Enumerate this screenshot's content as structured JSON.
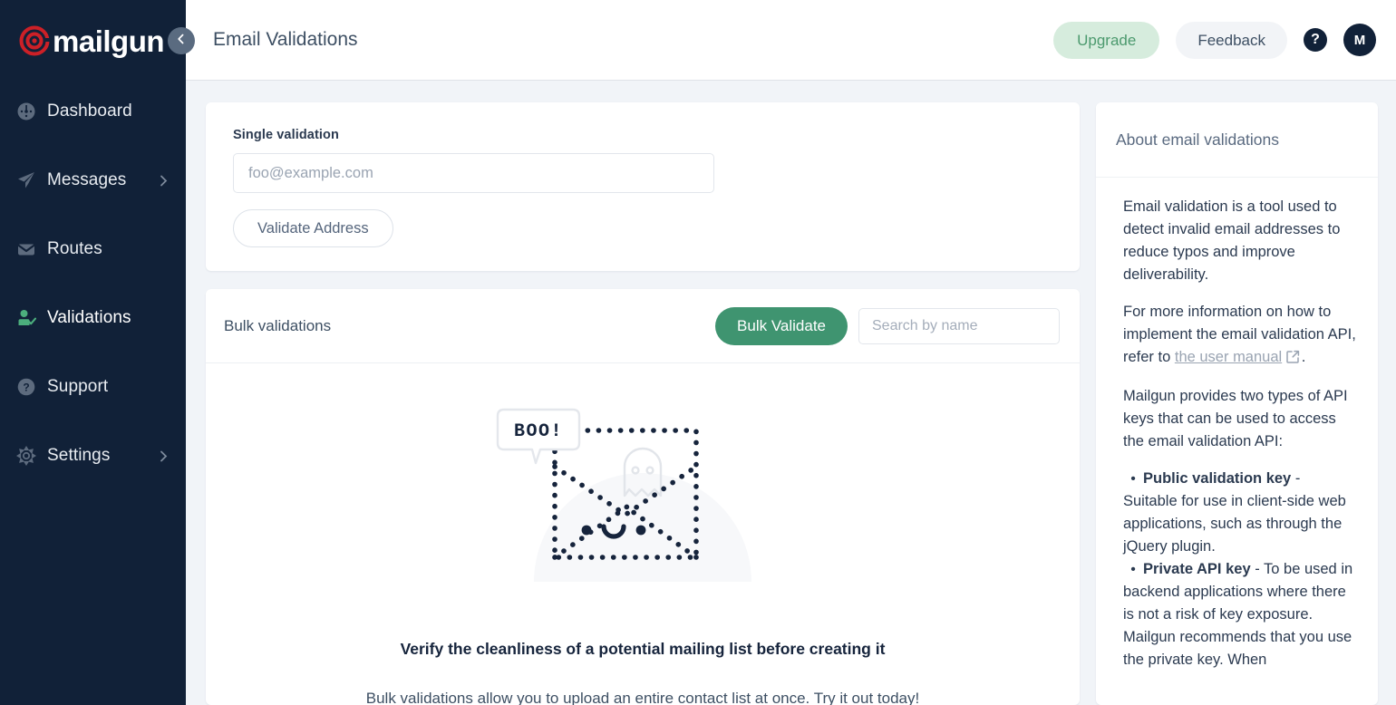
{
  "brand": {
    "name": "mailgun",
    "logo_mark": "at-sign-icon",
    "accent_green": "#3f9470",
    "sidebar_bg": "#112138"
  },
  "sidebar": {
    "collapse_icon": "chevron-left-icon",
    "items": [
      {
        "label": "Dashboard",
        "icon": "gauge-icon",
        "active": false,
        "chevron": false
      },
      {
        "label": "Messages",
        "icon": "paper-plane-icon",
        "active": false,
        "chevron": true
      },
      {
        "label": "Routes",
        "icon": "envelope-icon",
        "active": false,
        "chevron": false
      },
      {
        "label": "Validations",
        "icon": "user-check-icon",
        "active": true,
        "chevron": false
      },
      {
        "label": "Support",
        "icon": "question-circle-icon",
        "active": false,
        "chevron": false
      },
      {
        "label": "Settings",
        "icon": "gear-icon",
        "active": false,
        "chevron": true
      }
    ]
  },
  "header": {
    "title": "Email Validations",
    "upgrade_label": "Upgrade",
    "feedback_label": "Feedback",
    "help_icon": "question-mark-icon",
    "avatar_initial": "M"
  },
  "single_validation": {
    "label": "Single validation",
    "input_placeholder": "foo@example.com",
    "input_value": "",
    "button_label": "Validate Address"
  },
  "bulk_validations": {
    "title": "Bulk validations",
    "button_label": "Bulk Validate",
    "search_placeholder": "Search by name",
    "search_value": "",
    "empty_state": {
      "speech_bubble": "BOO!",
      "illustration": "dotted-envelope-with-ghost-icon",
      "title": "Verify the cleanliness of a potential mailing list before creating it",
      "subtitle": "Bulk validations allow you to upload an entire contact list at once. Try it out today!"
    }
  },
  "about_panel": {
    "title": "About email validations",
    "para1": "Email validation is a tool used to detect invalid email addresses to reduce typos and improve deliverability.",
    "para2_pre": "For more information on how to implement the email validation API, refer to ",
    "para2_link": "the user manual",
    "para2_link_icon": "external-link-icon",
    "para2_post": ".",
    "para3": "Mailgun provides two types of API keys that can be used to access the email validation API:",
    "bullets": [
      {
        "term": "Public validation key",
        "desc": " - Suitable for use in client-side web applications, such as through the jQuery plugin."
      },
      {
        "term": "Private API key",
        "desc": " - To be used in backend applications where there is not a risk of key exposure."
      }
    ],
    "para4": "Mailgun recommends that you use the private key. When"
  }
}
